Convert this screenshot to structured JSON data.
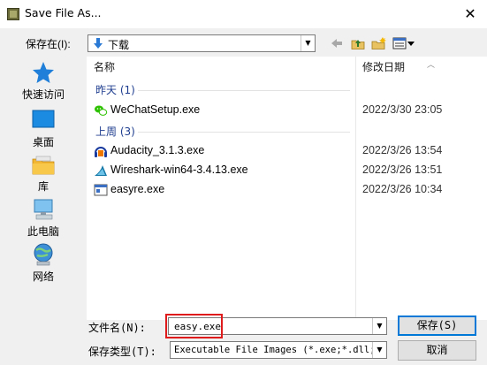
{
  "window": {
    "title": "Save File As..."
  },
  "toolbar": {
    "save_in_label": "保存在(I):",
    "save_in_value": "下载",
    "back_glyph": "⬅",
    "up_glyph": "⬆",
    "new_folder_glyph": "✱",
    "view_glyph": "▦▾"
  },
  "places": [
    {
      "label": "快速访问",
      "icon": "star-icon"
    },
    {
      "label": "桌面",
      "icon": "desktop-icon"
    },
    {
      "label": "库",
      "icon": "library-icon"
    },
    {
      "label": "此电脑",
      "icon": "computer-icon"
    },
    {
      "label": "网络",
      "icon": "network-icon"
    }
  ],
  "filelist": {
    "col_name": "名称",
    "col_date": "修改日期",
    "groups": [
      {
        "label": "昨天 (1)",
        "files": [
          {
            "name": "WeChatSetup.exe",
            "date": "2022/3/30 23:05",
            "icon": "wechat-icon"
          }
        ]
      },
      {
        "label": "上周 (3)",
        "files": [
          {
            "name": "Audacity_3.1.3.exe",
            "date": "2022/3/26 13:54",
            "icon": "audacity-icon"
          },
          {
            "name": "Wireshark-win64-3.4.13.exe",
            "date": "2022/3/26 13:51",
            "icon": "wireshark-icon"
          },
          {
            "name": "easyre.exe",
            "date": "2022/3/26 10:34",
            "icon": "exe-icon"
          }
        ]
      }
    ]
  },
  "bottom": {
    "filename_label": "文件名(N):",
    "filename_value": "easy.exe",
    "filetype_label": "保存类型(T):",
    "filetype_value": "Executable File Images (*.exe;*.dll;*",
    "save_button": "保存(S)",
    "cancel_button": "取消"
  },
  "colors": {
    "accent": "#0078d7",
    "highlight": "#e01b1b",
    "group": "#1e3d8f"
  }
}
